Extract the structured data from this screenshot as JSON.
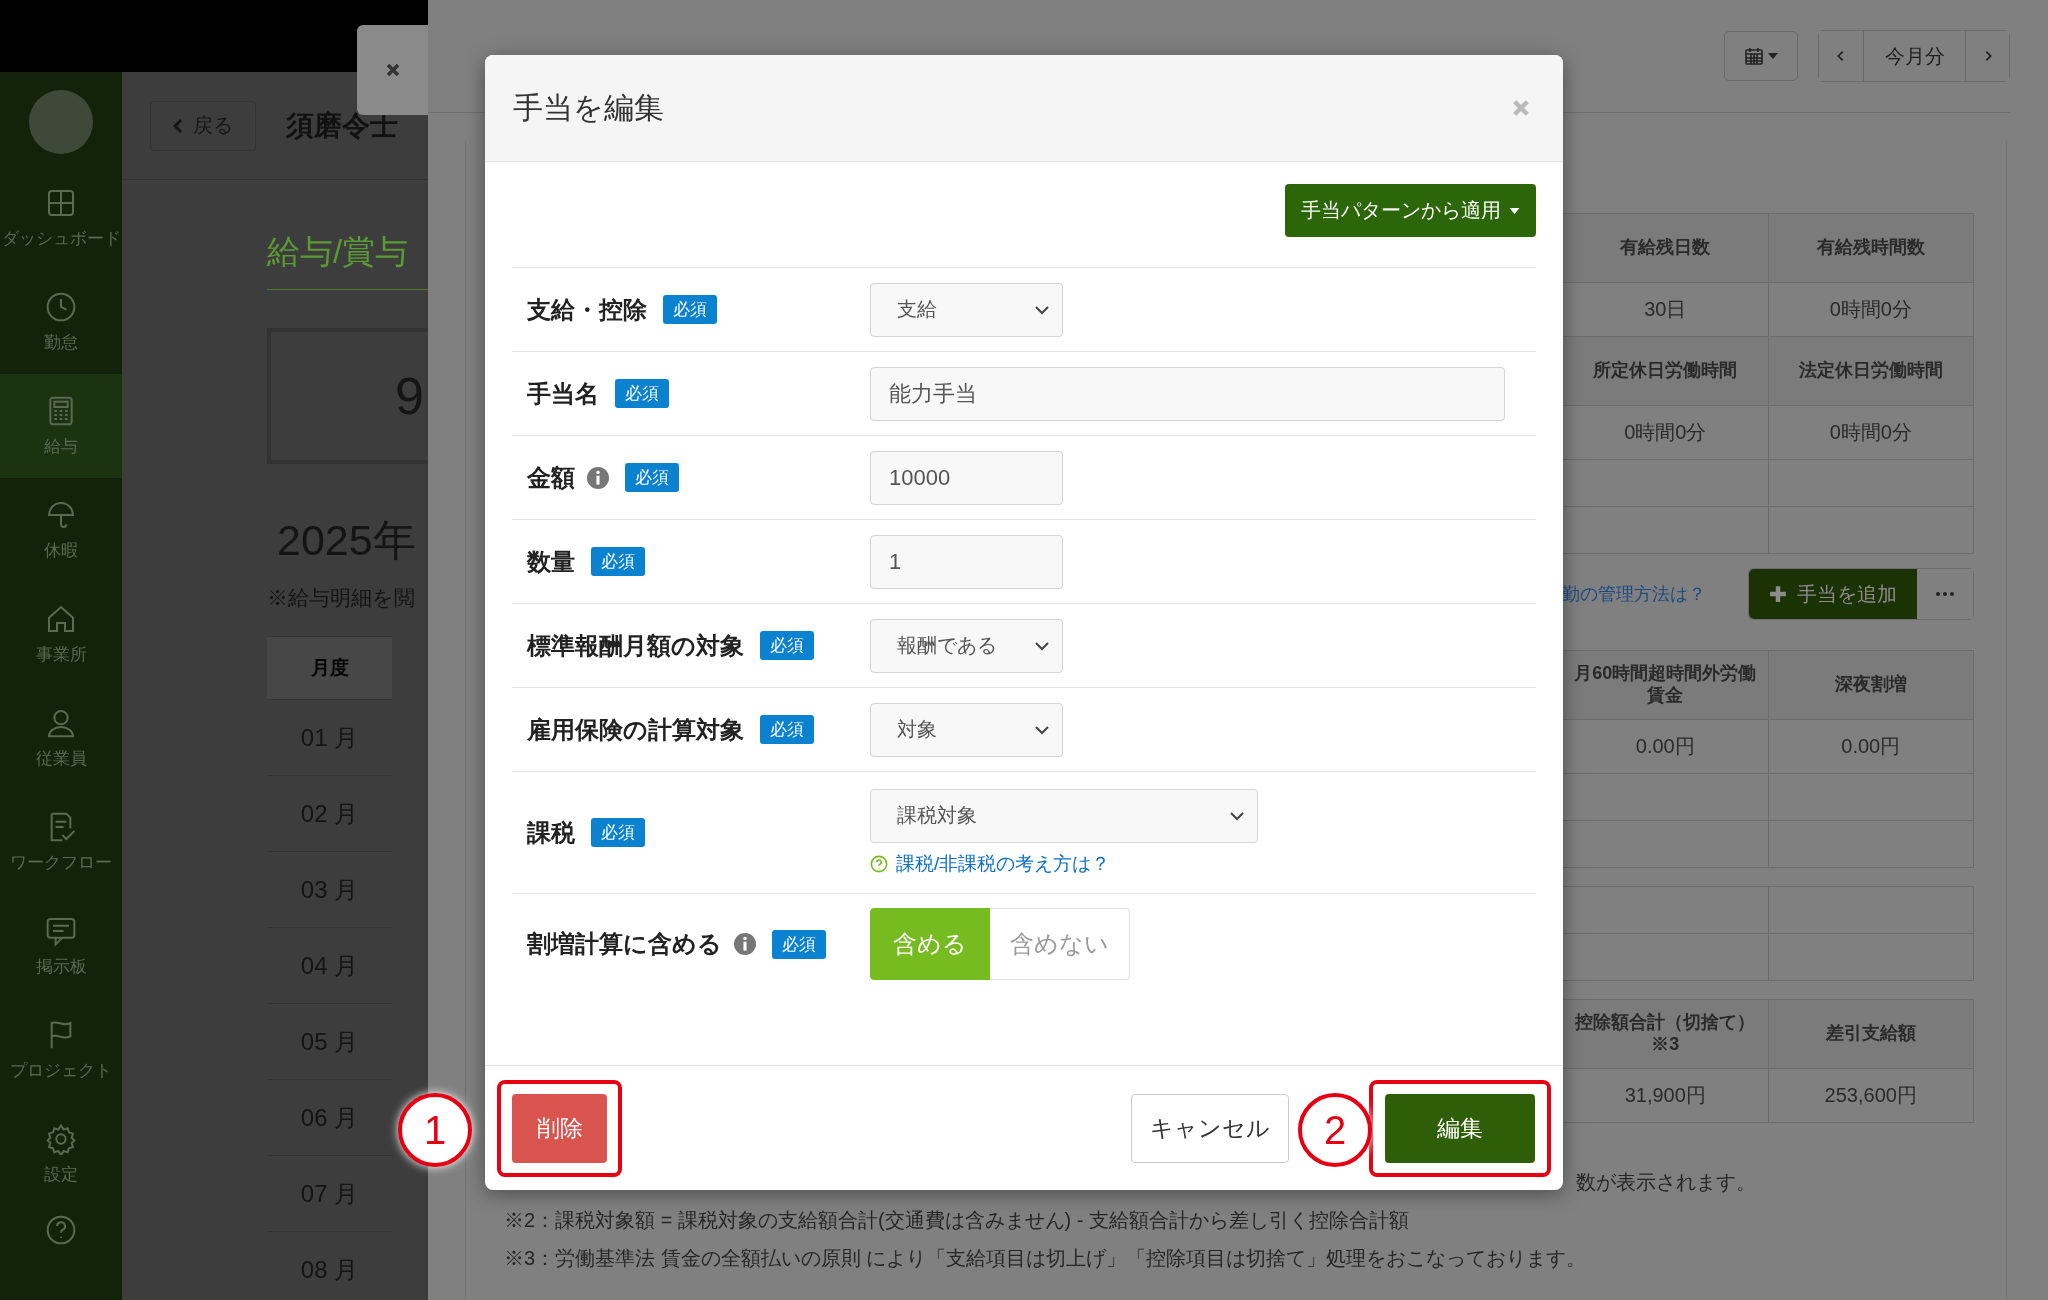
{
  "sidebar": {
    "items": [
      {
        "label": "ダッシュボード",
        "selected": false
      },
      {
        "label": "勤怠",
        "selected": false
      },
      {
        "label": "給与",
        "selected": true
      },
      {
        "label": "休暇",
        "selected": false
      },
      {
        "label": "事業所",
        "selected": false
      },
      {
        "label": "従業員",
        "selected": false
      },
      {
        "label": "ワークフロー",
        "selected": false
      },
      {
        "label": "掲示板",
        "selected": false
      },
      {
        "label": "プロジェクト",
        "selected": false
      },
      {
        "label": "設定",
        "selected": false
      }
    ]
  },
  "header": {
    "back_button": "戻る",
    "title": "須磨令士"
  },
  "page": {
    "heading": "給与/賞与",
    "summary_value": "9",
    "year": "2025年",
    "note": "※給与明細を閲",
    "table": {
      "columns": [
        "月度"
      ],
      "rows": [
        "01 月",
        "02 月",
        "03 月",
        "04 月",
        "05 月",
        "06 月",
        "07 月",
        "08 月"
      ]
    }
  },
  "drawer": {
    "month_button": "今月分",
    "tables": [
      {
        "rows": [
          {
            "kind": "header",
            "cells": [
              "有給残日数",
              "有給残時間数"
            ]
          },
          {
            "kind": "value",
            "cells": [
              "30日",
              "0時間0分"
            ]
          },
          {
            "kind": "header",
            "cells": [
              "所定休日労働時間",
              "法定休日労働時間"
            ]
          },
          {
            "kind": "value",
            "cells": [
              "0時間0分",
              "0時間0分"
            ]
          },
          {
            "kind": "empty"
          },
          {
            "kind": "empty"
          }
        ]
      },
      {
        "rows": [
          {
            "kind": "header",
            "cells": [
              "月60時間超時間外労働賃金",
              "深夜割増"
            ]
          },
          {
            "kind": "value",
            "cells": [
              "0.00円",
              "0.00円"
            ]
          },
          {
            "kind": "empty"
          },
          {
            "kind": "empty"
          }
        ]
      },
      {
        "rows": [
          {
            "kind": "empty"
          },
          {
            "kind": "empty"
          }
        ]
      },
      {
        "rows": [
          {
            "kind": "header",
            "cells": [
              "控除額合計（切捨て）※3",
              "差引支給額"
            ]
          },
          {
            "kind": "value",
            "cells": [
              "31,900円",
              "253,600円"
            ]
          }
        ]
      }
    ],
    "help_link": "勤の管理方法は？",
    "add_button": "手当を追加",
    "footnotes": [
      "数が表示されます。",
      "※2：課税対象額 = 課税対象の支給額合計(交通費は含みません) - 支給額合計から差し引く控除合計額",
      "※3：労働基準法 賃金の全額払いの原則 により「支給項目は切上げ」「控除項目は切捨て」処理をおこなっております。"
    ]
  },
  "modal": {
    "title": "手当を編集",
    "pattern_button": "手当パターンから適用",
    "fields": [
      {
        "label": "支給・控除",
        "required": "必須",
        "info": false,
        "kind": "select",
        "value": "支給"
      },
      {
        "label": "手当名",
        "required": "必須",
        "info": false,
        "kind": "text",
        "value": "能力手当"
      },
      {
        "label": "金額",
        "required": "必須",
        "info": true,
        "kind": "number",
        "value": "10000"
      },
      {
        "label": "数量",
        "required": "必須",
        "info": false,
        "kind": "number",
        "value": "1"
      },
      {
        "label": "標準報酬月額の対象",
        "required": "必須",
        "info": false,
        "kind": "select",
        "value": "報酬である"
      },
      {
        "label": "雇用保険の計算対象",
        "required": "必須",
        "info": false,
        "kind": "select",
        "value": "対象"
      },
      {
        "label": "課税",
        "required": "必須",
        "info": false,
        "kind": "wide_select",
        "value": "課税対象",
        "help_link": "課税/非課税の考え方は？"
      },
      {
        "label": "割増計算に含める",
        "required": "必須",
        "info": true,
        "kind": "toggle",
        "options": [
          {
            "label": "含める",
            "selected": true
          },
          {
            "label": "含めない",
            "selected": false
          }
        ]
      }
    ],
    "delete_button": "削除",
    "cancel_button": "キャンセル",
    "submit_button": "編集"
  },
  "annotations": [
    {
      "label": "1"
    },
    {
      "label": "2"
    }
  ]
}
